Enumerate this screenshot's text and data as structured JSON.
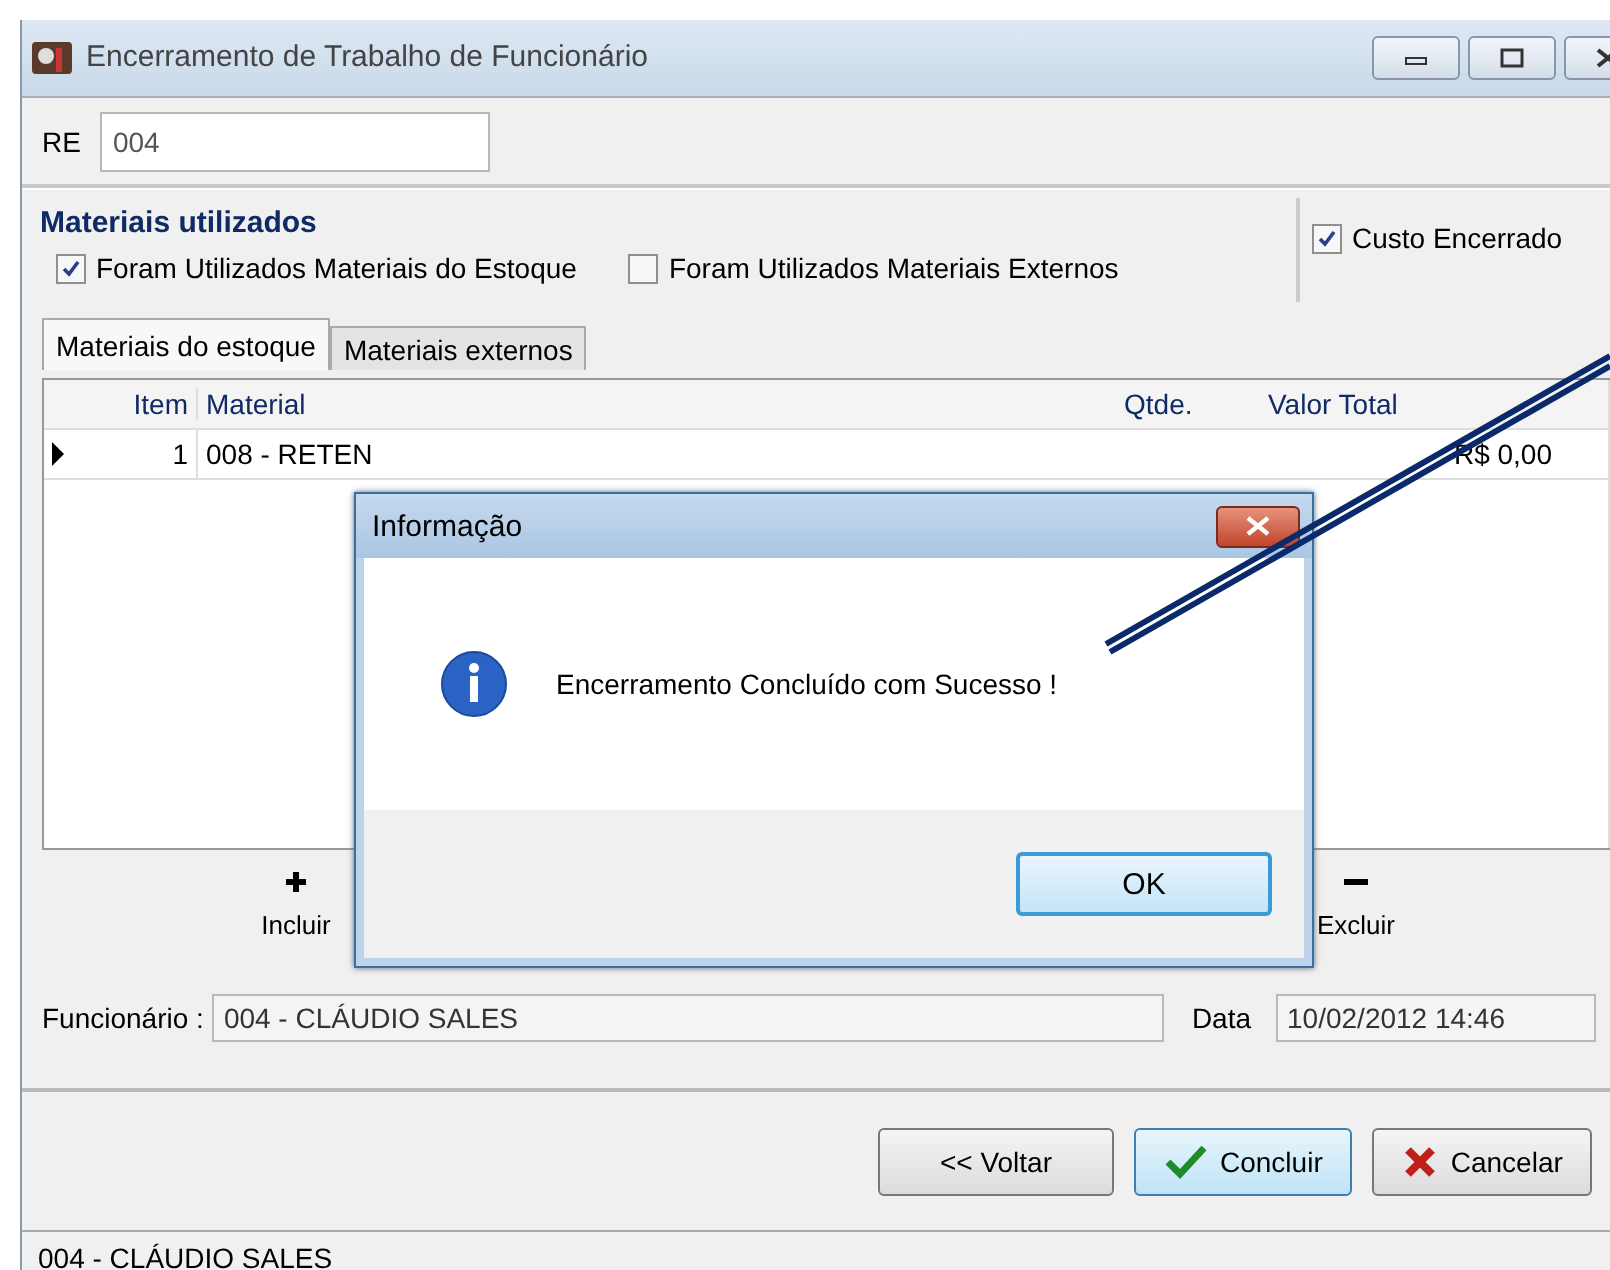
{
  "window": {
    "title": "Encerramento de Trabalho de Funcionário"
  },
  "re": {
    "label": "RE",
    "value": "004"
  },
  "materials": {
    "title": "Materiais utilizados",
    "checkboxes": [
      {
        "label": "Foram Utilizados Materiais do Estoque",
        "checked": true
      },
      {
        "label": "Foram Utilizados Materiais Externos",
        "checked": false
      }
    ],
    "cost_closed": {
      "label": "Custo Encerrado",
      "checked": true
    },
    "tabs": [
      {
        "label": "Materiais do estoque",
        "selected": true
      },
      {
        "label": "Materiais externos",
        "selected": false
      }
    ],
    "table": {
      "columns": [
        "Item",
        "Material",
        "Qtde.",
        "Valor Total"
      ],
      "rows": [
        {
          "selected": true,
          "cells": [
            "1",
            "008 - RETEN",
            "",
            "R$ 0,00"
          ]
        }
      ]
    },
    "actions": [
      {
        "kind": "add",
        "label": "Incluir"
      },
      {
        "kind": "remove",
        "label": "Excluir"
      }
    ],
    "employee": {
      "label": "Funcionário :",
      "value": "004 - CLÁUDIO SALES"
    },
    "date": {
      "label": "Data",
      "value": "10/02/2012 14:46"
    }
  },
  "buttons": [
    {
      "kind": "back",
      "label": "<< Voltar",
      "focused": false
    },
    {
      "kind": "confirm",
      "label": "Concluir",
      "focused": true
    },
    {
      "kind": "cancel",
      "label": "Cancelar",
      "focused": false
    }
  ],
  "status_bar": "004 - CLÁUDIO SALES",
  "dialog": {
    "title": "Informação",
    "message": "Encerramento Concluído com Sucesso !",
    "button": "OK"
  }
}
